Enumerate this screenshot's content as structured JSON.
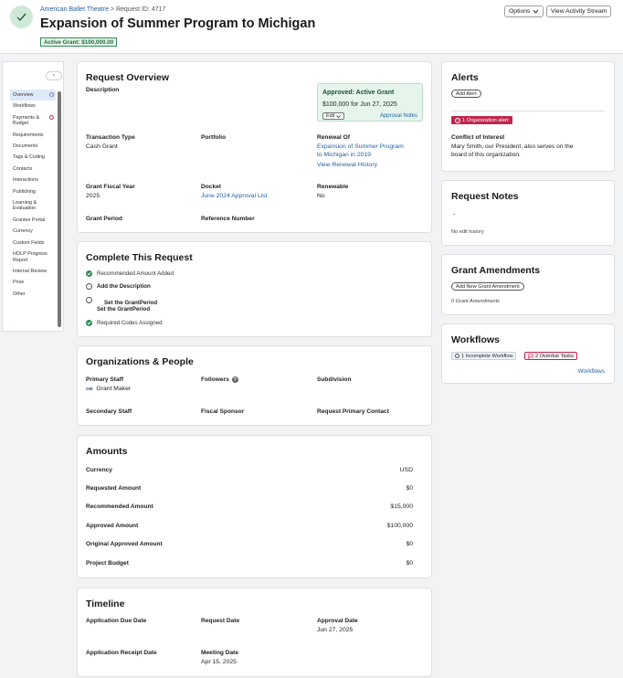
{
  "header": {
    "org": "American Ballet Theatre",
    "separator": " > ",
    "request_id": "Request ID: 4717",
    "title": "Expansion of Summer Program to Michigan",
    "active_grant": "Active Grant: $100,000.00",
    "options_label": "Options",
    "activity_label": "View Activity Stream"
  },
  "sidebar": {
    "items": [
      {
        "label": "Overview"
      },
      {
        "label": "Workflows"
      },
      {
        "label": "Payments & Budget"
      },
      {
        "label": "Requirements"
      },
      {
        "label": "Documents"
      },
      {
        "label": "Tags & Coding"
      },
      {
        "label": "Contacts"
      },
      {
        "label": "Interactions"
      },
      {
        "label": "Publishing"
      },
      {
        "label": "Learning & Evaluation"
      },
      {
        "label": "Grantee Portal"
      },
      {
        "label": "Currency"
      },
      {
        "label": "Custom Fields"
      },
      {
        "label": "HOLP Progress Report"
      },
      {
        "label": "Internal Review"
      },
      {
        "label": "Prize"
      },
      {
        "label": "Other"
      }
    ]
  },
  "overview": {
    "title": "Request Overview",
    "description_label": "Description",
    "approved_title": "Approved: Active Grant",
    "approved_amount": "$100,000 for Jun 27, 2025",
    "edit_label": "Edit",
    "approval_notes": "Approval Notes",
    "transaction_type_label": "Transaction Type",
    "transaction_type": "Cash Grant",
    "portfolio_label": "Portfolio",
    "renewal_of_label": "Renewal Of",
    "renewal_of_line1": "Expansion of Summer Program",
    "renewal_of_line2": "to Michigan in 2019",
    "view_renewal": "View Renewal History",
    "fiscal_year_label": "Grant Fiscal Year",
    "fiscal_year": "2025",
    "docket_label": "Docket",
    "docket": "June 2024 Approval List",
    "renewable_label": "Renewable",
    "renewable": "No",
    "grant_period_label": "Grant Period",
    "reference_number_label": "Reference Number"
  },
  "complete": {
    "title": "Complete This Request",
    "tasks": [
      "Recommended Amount Added",
      "Add the Description",
      "Set the GrantPeriod",
      "Set the GrantPeriod",
      "Required Codes Assigned"
    ]
  },
  "orgs": {
    "title": "Organizations & People",
    "primary_staff_label": "Primary Staff",
    "primary_staff_initials": "GM",
    "primary_staff": "Grant Maker",
    "followers_label": "Followers",
    "subdivision_label": "Subdivision",
    "secondary_staff_label": "Secondary Staff",
    "fiscal_sponsor_label": "Fiscal Sponsor",
    "primary_contact_label": "Request Primary Contact"
  },
  "amounts": {
    "title": "Amounts",
    "rows": [
      {
        "label": "Currency",
        "value": "USD"
      },
      {
        "label": "Requested Amount",
        "value": "$0"
      },
      {
        "label": "Recommended Amount",
        "value": "$15,000"
      },
      {
        "label": "Approved Amount",
        "value": "$100,000"
      },
      {
        "label": "Original Approved Amount",
        "value": "$0"
      },
      {
        "label": "Project Budget",
        "value": "$0"
      }
    ]
  },
  "timeline": {
    "title": "Timeline",
    "app_due_label": "Application Due Date",
    "request_date_label": "Request Date",
    "approval_date_label": "Approval Date",
    "approval_date": "Jun 27, 2025",
    "receipt_date_label": "Application Receipt Date",
    "meeting_date_label": "Meeting Date",
    "meeting_date": "Apr 15, 2025"
  },
  "alerts": {
    "title": "Alerts",
    "add_alert": "Add Alert",
    "org_alert": "1 Organization alert",
    "conflict_title": "Conflict of Interest",
    "conflict_line1": "Mary Smith, our President, also serves on the",
    "conflict_line2": "board of this organization."
  },
  "notes": {
    "title": "Request Notes",
    "dash": "-",
    "history": "No edit history"
  },
  "amendments": {
    "title": "Grant Amendments",
    "add_label": "Add New Grant Amendment",
    "count": "0 Grant Amendments"
  },
  "workflows": {
    "title": "Workflows",
    "incomplete": "1 Incomplete Workflow",
    "overdue": "2 Overdue Tasks",
    "link": "Workflows"
  },
  "colors": {
    "link": "#1f5f9e",
    "success": "#2e8b57",
    "alert": "#c0264d"
  }
}
